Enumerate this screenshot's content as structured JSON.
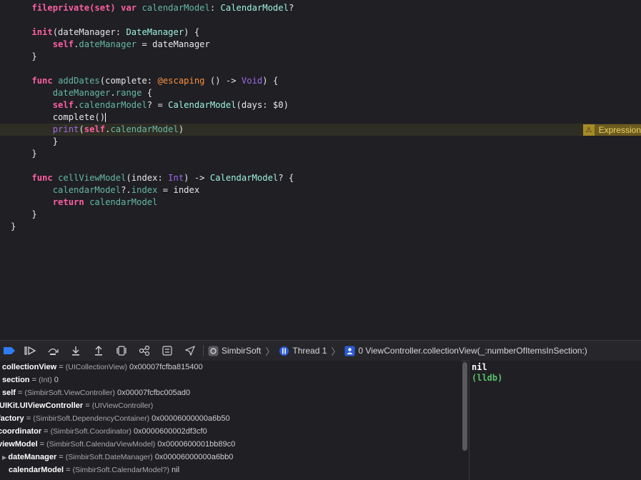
{
  "editor": {
    "lines": [
      {
        "tokens": [
          [
            "    ",
            "plain"
          ],
          [
            "fileprivate(set)",
            "kw"
          ],
          [
            " ",
            "plain"
          ],
          [
            "var",
            "kw"
          ],
          [
            " ",
            "plain"
          ],
          [
            "calendarModel",
            "prop"
          ],
          [
            ": ",
            "plain"
          ],
          [
            "CalendarModel",
            "proj-type"
          ],
          [
            "?",
            "plain"
          ]
        ]
      },
      {
        "tokens": []
      },
      {
        "tokens": [
          [
            "    ",
            "plain"
          ],
          [
            "init",
            "kw"
          ],
          [
            "(dateManager: ",
            "plain"
          ],
          [
            "DateManager",
            "proj-type"
          ],
          [
            ") {",
            "plain"
          ]
        ]
      },
      {
        "tokens": [
          [
            "        ",
            "plain"
          ],
          [
            "self",
            "kw"
          ],
          [
            ".",
            "plain"
          ],
          [
            "dateManager",
            "prop"
          ],
          [
            " = dateManager",
            "plain"
          ]
        ]
      },
      {
        "tokens": [
          [
            "    }",
            "plain"
          ]
        ]
      },
      {
        "tokens": []
      },
      {
        "tokens": [
          [
            "    ",
            "plain"
          ],
          [
            "func",
            "kw"
          ],
          [
            " ",
            "plain"
          ],
          [
            "addDates",
            "func"
          ],
          [
            "(complete: ",
            "plain"
          ],
          [
            "@escaping",
            "attr"
          ],
          [
            " () -> ",
            "plain"
          ],
          [
            "Void",
            "sys"
          ],
          [
            ") {",
            "plain"
          ]
        ]
      },
      {
        "tokens": [
          [
            "        ",
            "plain"
          ],
          [
            "dateManager",
            "prop"
          ],
          [
            ".",
            "plain"
          ],
          [
            "range",
            "prop"
          ],
          [
            " {",
            "plain"
          ]
        ]
      },
      {
        "tokens": [
          [
            "        ",
            "plain"
          ],
          [
            "self",
            "kw"
          ],
          [
            ".",
            "plain"
          ],
          [
            "calendarModel",
            "prop"
          ],
          [
            "? = ",
            "plain"
          ],
          [
            "CalendarModel",
            "proj-type"
          ],
          [
            "(days: ",
            "plain"
          ],
          [
            "$0",
            "plain"
          ],
          [
            ")",
            "plain"
          ]
        ]
      },
      {
        "tokens": [
          [
            "        complete()",
            "plain"
          ]
        ],
        "cursor": true
      },
      {
        "tokens": [
          [
            "        ",
            "plain"
          ],
          [
            "print",
            "sys"
          ],
          [
            "(",
            "plain"
          ],
          [
            "self",
            "kw"
          ],
          [
            ".",
            "plain"
          ],
          [
            "calendarModel",
            "prop"
          ],
          [
            ")",
            "plain"
          ]
        ],
        "current": true
      },
      {
        "tokens": [
          [
            "        }",
            "plain"
          ]
        ]
      },
      {
        "tokens": [
          [
            "    }",
            "plain"
          ]
        ]
      },
      {
        "tokens": []
      },
      {
        "tokens": [
          [
            "    ",
            "plain"
          ],
          [
            "func",
            "kw"
          ],
          [
            " ",
            "plain"
          ],
          [
            "cellViewModel",
            "func"
          ],
          [
            "(index: ",
            "plain"
          ],
          [
            "Int",
            "sys"
          ],
          [
            ") -> ",
            "plain"
          ],
          [
            "CalendarModel",
            "proj-type"
          ],
          [
            "? {",
            "plain"
          ]
        ]
      },
      {
        "tokens": [
          [
            "        ",
            "plain"
          ],
          [
            "calendarModel",
            "prop"
          ],
          [
            "?.",
            "plain"
          ],
          [
            "index",
            "prop"
          ],
          [
            " = index",
            "plain"
          ]
        ]
      },
      {
        "tokens": [
          [
            "        ",
            "plain"
          ],
          [
            "return",
            "kw"
          ],
          [
            " ",
            "plain"
          ],
          [
            "calendarModel",
            "prop"
          ]
        ]
      },
      {
        "tokens": [
          [
            "    }",
            "plain"
          ]
        ]
      },
      {
        "tokens": [
          [
            "}",
            "plain"
          ]
        ]
      }
    ],
    "issue_label": "Expression"
  },
  "debugbar": {
    "buttons": [
      "breakpoints-toggle-icon",
      "continue-icon",
      "step-over-icon",
      "step-into-icon",
      "step-out-icon",
      "view-debugger-icon",
      "memory-graph-icon",
      "environment-overrides-icon",
      "simulate-location-icon"
    ],
    "target": "SimbirSoft",
    "thread": "Thread 1",
    "frame": "0 ViewController.collectionView(_:numberOfItemsInSection:)"
  },
  "variables": [
    {
      "name": "collectionView",
      "type": "(UICollectionView)",
      "value": "0x00007fcfba815400"
    },
    {
      "name": "section",
      "type": "(Int)",
      "value": "0"
    },
    {
      "name": "self",
      "type": "(SimbirSoft.ViewController)",
      "value": "0x00007fcfbc005ad0"
    },
    {
      "name": "UIKit.UIViewController",
      "type": "(UIViewController)",
      "value": ""
    },
    {
      "name": "factory",
      "type": "(SimbirSoft.DependencyContainer)",
      "value": "0x00006000000a6b50"
    },
    {
      "name": "coordinator",
      "type": "(SimbirSoft.Coordinator)",
      "value": "0x0000600002df3cf0"
    },
    {
      "name": "viewModel",
      "type": "(SimbirSoft.CalendarViewModel)",
      "value": "0x0000600001bb89c0"
    },
    {
      "name": "dateManager",
      "type": "(SimbirSoft.DateManager)",
      "value": "0x00006000000a6bb0"
    },
    {
      "name": "calendarModel",
      "type": "(SimbirSoft.CalendarModel?)",
      "value": "nil"
    }
  ],
  "console": {
    "lines": [
      "nil",
      "(lldb)"
    ]
  }
}
